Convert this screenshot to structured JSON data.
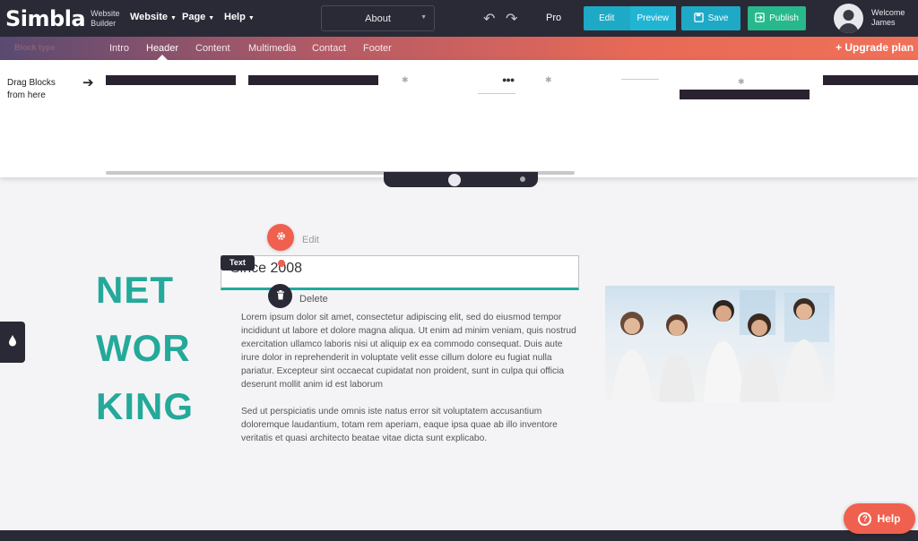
{
  "topbar": {
    "logo_text": "Simbla",
    "logo_sub_line1": "Website",
    "logo_sub_line2": "Builder",
    "menu": [
      "Website",
      "Page",
      "Help"
    ],
    "current_page": "About",
    "pro_label": "Pro",
    "edit_label": "Edit",
    "preview_label": "Preview",
    "save_label": "Save",
    "publish_label": "Publish",
    "welcome_line1": "Welcome",
    "welcome_line2": "James"
  },
  "blockbar": {
    "label": "Block type",
    "categories": [
      "Intro",
      "Header",
      "Content",
      "Multimedia",
      "Contact",
      "Footer"
    ],
    "active_category": "Header",
    "upgrade_label": "+ Upgrade plan"
  },
  "blocks_panel": {
    "drag_hint_line1": "Drag Blocks",
    "drag_hint_line2": "from here"
  },
  "canvas": {
    "headline_lines": [
      "NET",
      "WOR",
      "KING"
    ],
    "edit_label": "Edit",
    "text_tag": "Text",
    "text_value": "Since 2008",
    "delete_label": "Delete",
    "paragraph1": "Lorem ipsum dolor sit amet, consectetur adipiscing elit, sed do eiusmod tempor incididunt ut labore et dolore magna aliqua. Ut enim ad minim veniam, quis nostrud exercitation ullamco laboris nisi ut aliquip ex ea commodo consequat. Duis aute irure dolor in reprehenderit in voluptate velit esse cillum dolore eu fugiat nulla pariatur. Excepteur sint occaecat cupidatat non proident, sunt in culpa qui officia deserunt mollit anim id est laborum",
    "paragraph2": "Sed ut perspiciatis unde omnis iste natus error sit voluptatem accusantium doloremque laudantium, totam rem aperiam, eaque ipsa quae ab illo inventore veritatis et quasi architecto beatae vitae dicta sunt explicabo."
  },
  "help_label": "Help",
  "colors": {
    "topbar": "#2a2a36",
    "accent_teal": "#24a99a",
    "accent_blue": "#1ea9c6",
    "publish_green": "#27b88b",
    "accent_coral": "#f0604e"
  }
}
